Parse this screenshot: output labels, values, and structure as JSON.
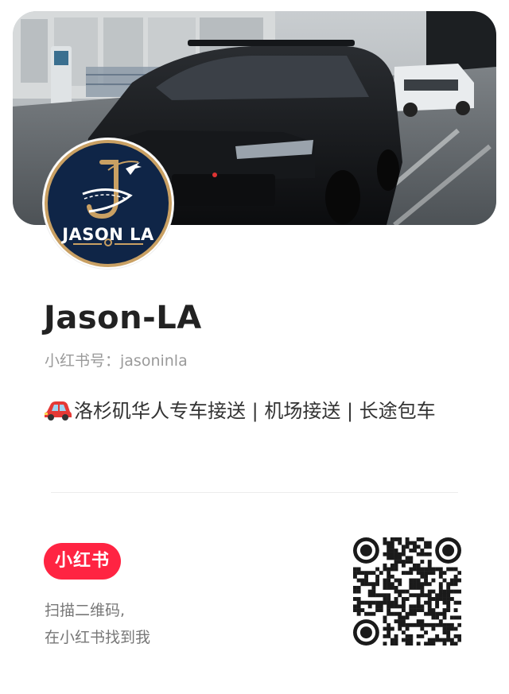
{
  "profile": {
    "name": "Jason-LA",
    "red_id": "小红书号：jasoninla",
    "bio": "洛杉矶华人专车接送 | 机场接送 | 长途包车",
    "bio_emoji": "car-emoji",
    "avatar_text": "JASON LA"
  },
  "footer": {
    "brand_label": "小红书",
    "scan_line1": "扫描二维码,",
    "scan_line2": "在小红书找到我"
  },
  "colors": {
    "brand_red": "#ff2442",
    "avatar_navy": "#0f2547",
    "avatar_gold": "#c9a063"
  }
}
